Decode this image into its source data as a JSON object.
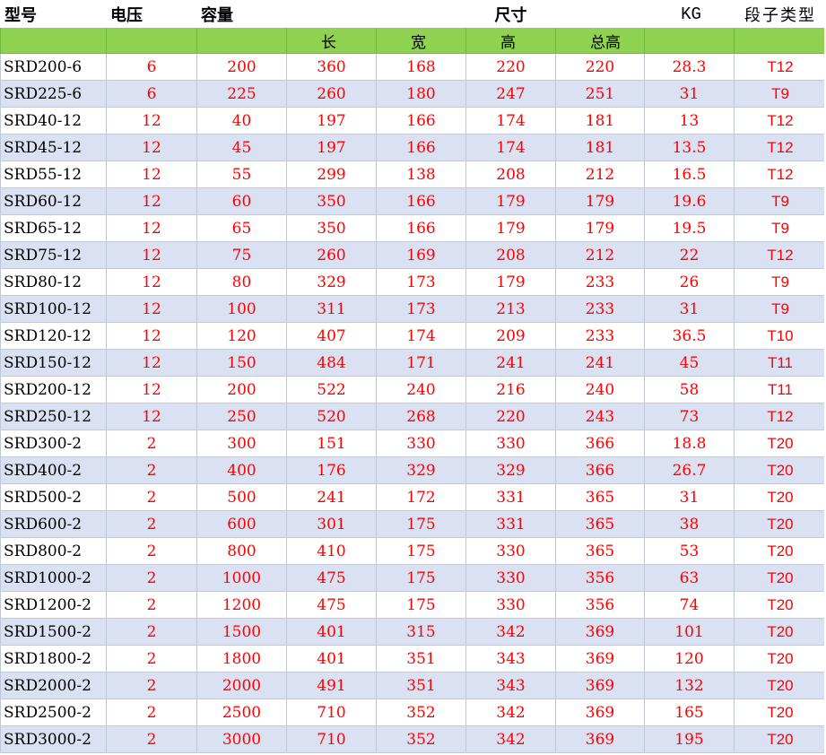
{
  "header": {
    "model": "型号",
    "voltage": "电压",
    "capacity": "容量",
    "dimensions": "尺寸",
    "kg": "KG",
    "terminal": "段子类型",
    "sub": [
      "长",
      "宽",
      "高",
      "总高"
    ]
  },
  "rows": [
    [
      "SRD200-6",
      "6",
      "200",
      "360",
      "168",
      "220",
      "220",
      "28.3",
      "T12"
    ],
    [
      "SRD225-6",
      "6",
      "225",
      "260",
      "180",
      "247",
      "251",
      "31",
      "T9"
    ],
    [
      "SRD40-12",
      "12",
      "40",
      "197",
      "166",
      "174",
      "181",
      "13",
      "T12"
    ],
    [
      "SRD45-12",
      "12",
      "45",
      "197",
      "166",
      "174",
      "181",
      "13.5",
      "T12"
    ],
    [
      "SRD55-12",
      "12",
      "55",
      "299",
      "138",
      "208",
      "212",
      "16.5",
      "T12"
    ],
    [
      "SRD60-12",
      "12",
      "60",
      "350",
      "166",
      "179",
      "179",
      "19.6",
      "T9"
    ],
    [
      "SRD65-12",
      "12",
      "65",
      "350",
      "166",
      "179",
      "179",
      "19.5",
      "T9"
    ],
    [
      "SRD75-12",
      "12",
      "75",
      "260",
      "169",
      "208",
      "212",
      "22",
      "T12"
    ],
    [
      "SRD80-12",
      "12",
      "80",
      "329",
      "173",
      "179",
      "233",
      "26",
      "T9"
    ],
    [
      "SRD100-12",
      "12",
      "100",
      "311",
      "173",
      "213",
      "233",
      "31",
      "T9"
    ],
    [
      "SRD120-12",
      "12",
      "120",
      "407",
      "174",
      "209",
      "233",
      "36.5",
      "T10"
    ],
    [
      "SRD150-12",
      "12",
      "150",
      "484",
      "171",
      "241",
      "241",
      "45",
      "T11"
    ],
    [
      "SRD200-12",
      "12",
      "200",
      "522",
      "240",
      "216",
      "240",
      "58",
      "T11"
    ],
    [
      "SRD250-12",
      "12",
      "250",
      "520",
      "268",
      "220",
      "243",
      "73",
      "T12"
    ],
    [
      "SRD300-2",
      "2",
      "300",
      "151",
      "330",
      "330",
      "366",
      "18.8",
      "T20"
    ],
    [
      "SRD400-2",
      "2",
      "400",
      "176",
      "329",
      "329",
      "366",
      "26.7",
      "T20"
    ],
    [
      "SRD500-2",
      "2",
      "500",
      "241",
      "172",
      "331",
      "365",
      "31",
      "T20"
    ],
    [
      "SRD600-2",
      "2",
      "600",
      "301",
      "175",
      "331",
      "365",
      "38",
      "T20"
    ],
    [
      "SRD800-2",
      "2",
      "800",
      "410",
      "175",
      "330",
      "365",
      "53",
      "T20"
    ],
    [
      "SRD1000-2",
      "2",
      "1000",
      "475",
      "175",
      "330",
      "356",
      "63",
      "T20"
    ],
    [
      "SRD1200-2",
      "2",
      "1200",
      "475",
      "175",
      "330",
      "356",
      "74",
      "T20"
    ],
    [
      "SRD1500-2",
      "2",
      "1500",
      "401",
      "315",
      "342",
      "369",
      "101",
      "T20"
    ],
    [
      "SRD1800-2",
      "2",
      "1800",
      "401",
      "351",
      "343",
      "369",
      "120",
      "T20"
    ],
    [
      "SRD2000-2",
      "2",
      "2000",
      "491",
      "351",
      "343",
      "369",
      "132",
      "T20"
    ],
    [
      "SRD2500-2",
      "2",
      "2500",
      "710",
      "352",
      "342",
      "369",
      "165",
      "T20"
    ],
    [
      "SRD3000-2",
      "2",
      "3000",
      "710",
      "352",
      "342",
      "369",
      "195",
      "T20"
    ]
  ],
  "colors": {
    "header_green": "#8fd150",
    "band_blue": "#d9e1f2",
    "value_red": "#ff0000"
  }
}
